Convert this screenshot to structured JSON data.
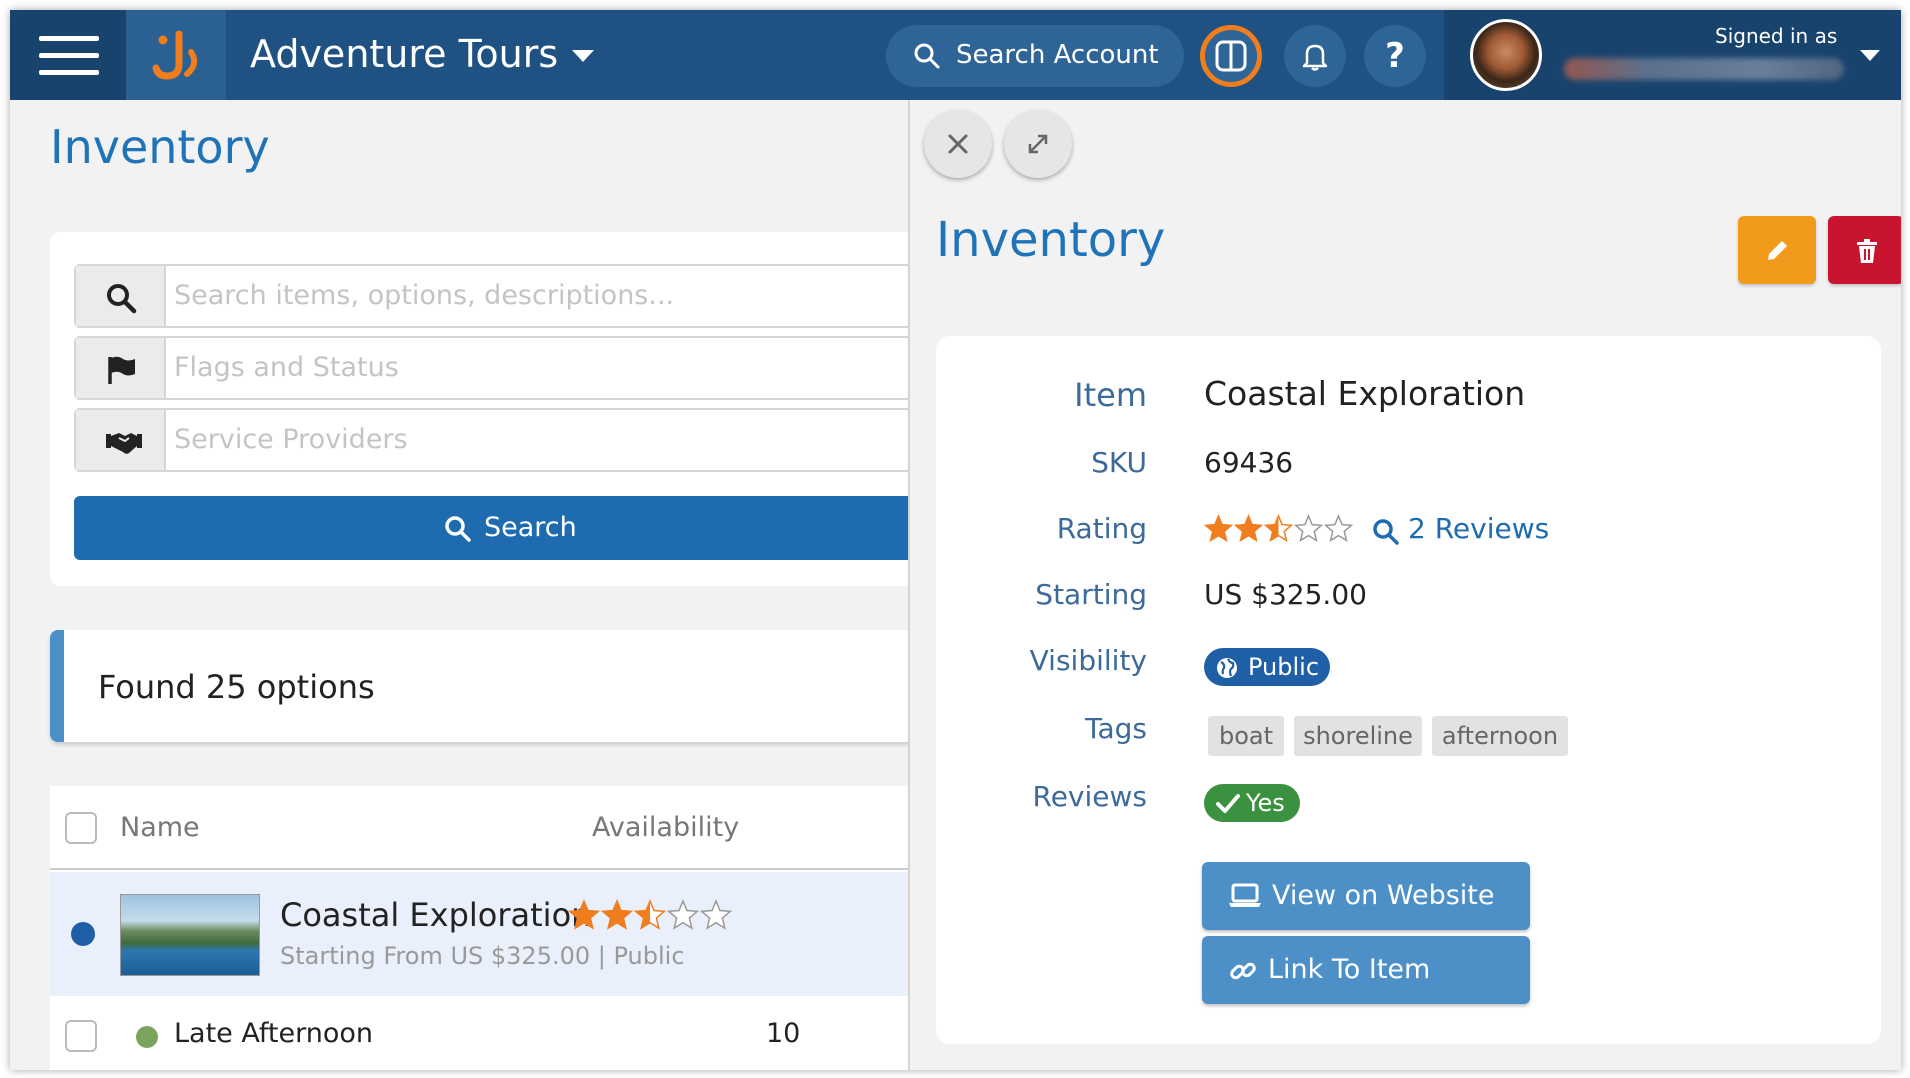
{
  "header": {
    "app_title": "Adventure Tours",
    "search_label": "Search Account",
    "help_label": "?",
    "signed_in_label": "Signed in as"
  },
  "icons": {
    "menu": "hamburger-icon",
    "logo": "brand-logo",
    "search": "search-icon",
    "panel_toggle": "split-panel-icon",
    "notifications": "bell-icon",
    "help": "question-icon",
    "flag": "flag-icon",
    "providers": "handshake-icon",
    "close": "close-icon",
    "expand": "expand-icon",
    "edit": "pencil-icon",
    "delete": "trash-icon",
    "globe": "globe-icon",
    "check": "check-icon",
    "laptop": "laptop-icon",
    "link": "link-icon"
  },
  "colors": {
    "header": "#1f5282",
    "accent": "#f07d1e",
    "primary": "#1e6bb0",
    "star": "#f07d1e",
    "edit": "#f29a1b",
    "delete": "#c8142e",
    "success": "#3a9140"
  },
  "left": {
    "page_title": "Inventory",
    "filters": {
      "search_placeholder": "Search items, options, descriptions...",
      "flags_placeholder": "Flags and Status",
      "providers_placeholder": "Service Providers",
      "search_button": "Search"
    },
    "found_text": "Found 25 options",
    "table": {
      "columns": [
        "Name",
        "Availability"
      ],
      "rows": [
        {
          "name": "Coastal Exploration",
          "subtitle": "Starting From US $325.00 | Public",
          "rating": 2.5
        },
        {
          "name": "Late Afternoon",
          "availability": "10"
        }
      ]
    }
  },
  "panel": {
    "title": "Inventory",
    "fields": {
      "item_label": "Item",
      "item_value": "Coastal Exploration",
      "sku_label": "SKU",
      "sku_value": "69436",
      "rating_label": "Rating",
      "rating_value": 2.5,
      "reviews_link": "2 Reviews",
      "starting_label": "Starting",
      "starting_value": "US $325.00",
      "visibility_label": "Visibility",
      "visibility_value": "Public",
      "tags_label": "Tags",
      "tags": [
        "boat",
        "shoreline",
        "afternoon"
      ],
      "reviews_label": "Reviews",
      "reviews_value": "Yes"
    },
    "view_website_button": "View on Website",
    "link_item_button": "Link To Item"
  }
}
